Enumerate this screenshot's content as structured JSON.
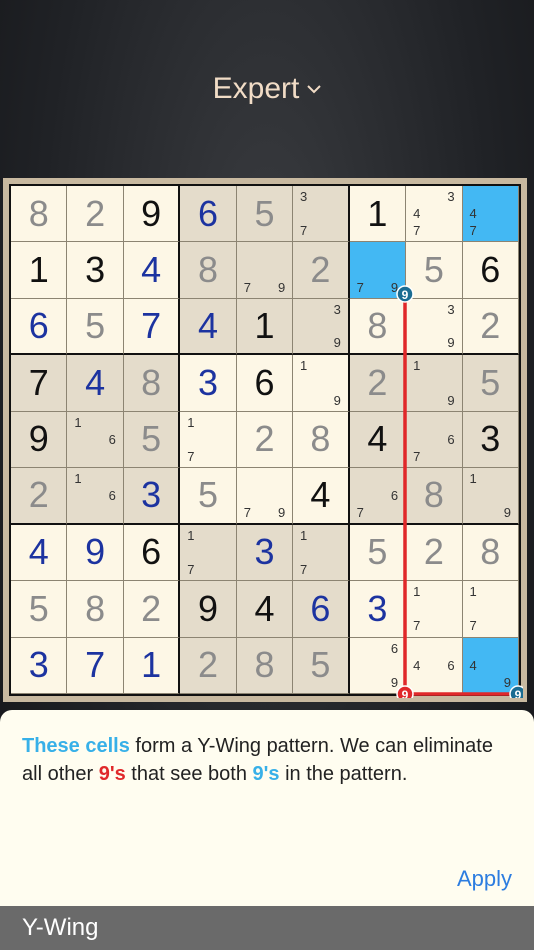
{
  "header": {
    "title": "Expert"
  },
  "colors": {
    "highlight": "#43b8f3",
    "chain": "#e0282a"
  },
  "board": {
    "rows": [
      [
        {
          "v": "8",
          "k": "given"
        },
        {
          "v": "2",
          "k": "given"
        },
        {
          "v": "9",
          "k": "black"
        },
        {
          "v": "6",
          "k": "blue"
        },
        {
          "v": "5",
          "k": "given"
        },
        {
          "c": [
            "3",
            "",
            "",
            "",
            "",
            "",
            "7",
            "",
            ""
          ]
        },
        {
          "v": "1",
          "k": "black"
        },
        {
          "c": [
            "",
            "",
            "3",
            "4",
            "",
            "",
            "7",
            "",
            ""
          ]
        },
        {
          "c": [
            "",
            "",
            "",
            "4",
            "",
            "",
            "7",
            "",
            ""
          ],
          "hl": true
        }
      ],
      [
        {
          "v": "1",
          "k": "black"
        },
        {
          "v": "3",
          "k": "black"
        },
        {
          "v": "4",
          "k": "blue"
        },
        {
          "v": "8",
          "k": "given"
        },
        {
          "c": [
            "",
            "",
            "",
            "",
            "",
            "",
            "7",
            "",
            "9"
          ]
        },
        {
          "v": "2",
          "k": "given"
        },
        {
          "c": [
            "",
            "",
            "",
            "",
            "",
            "",
            "7",
            "",
            "9"
          ],
          "hl": true
        },
        {
          "v": "5",
          "k": "given"
        },
        {
          "v": "6",
          "k": "black"
        }
      ],
      [
        {
          "v": "6",
          "k": "blue"
        },
        {
          "v": "5",
          "k": "given"
        },
        {
          "v": "7",
          "k": "blue"
        },
        {
          "v": "4",
          "k": "blue"
        },
        {
          "v": "1",
          "k": "black"
        },
        {
          "c": [
            "",
            "",
            "3",
            "",
            "",
            "",
            "",
            "",
            "9"
          ]
        },
        {
          "v": "8",
          "k": "given"
        },
        {
          "c": [
            "",
            "",
            "3",
            "",
            "",
            "",
            "",
            "",
            "9"
          ]
        },
        {
          "v": "2",
          "k": "given"
        }
      ],
      [
        {
          "v": "7",
          "k": "black"
        },
        {
          "v": "4",
          "k": "blue"
        },
        {
          "v": "8",
          "k": "given"
        },
        {
          "v": "3",
          "k": "blue"
        },
        {
          "v": "6",
          "k": "black"
        },
        {
          "c": [
            "1",
            "",
            "",
            "",
            "",
            "",
            "",
            "",
            "9"
          ]
        },
        {
          "v": "2",
          "k": "given"
        },
        {
          "c": [
            "1",
            "",
            "",
            "",
            "",
            "",
            "",
            "",
            "9"
          ]
        },
        {
          "v": "5",
          "k": "given"
        }
      ],
      [
        {
          "v": "9",
          "k": "black"
        },
        {
          "c": [
            "1",
            "",
            "",
            "",
            "",
            "6",
            "",
            "",
            ""
          ]
        },
        {
          "v": "5",
          "k": "given"
        },
        {
          "c": [
            "1",
            "",
            "",
            "",
            "",
            "",
            "7",
            "",
            ""
          ]
        },
        {
          "v": "2",
          "k": "given"
        },
        {
          "v": "8",
          "k": "given"
        },
        {
          "v": "4",
          "k": "black"
        },
        {
          "c": [
            "",
            "",
            "",
            "",
            "",
            "6",
            "7",
            "",
            ""
          ]
        },
        {
          "v": "3",
          "k": "black"
        }
      ],
      [
        {
          "v": "2",
          "k": "given"
        },
        {
          "c": [
            "1",
            "",
            "",
            "",
            "",
            "6",
            "",
            "",
            ""
          ]
        },
        {
          "v": "3",
          "k": "blue"
        },
        {
          "v": "5",
          "k": "given"
        },
        {
          "c": [
            "",
            "",
            "",
            "",
            "",
            "",
            "7",
            "",
            "9"
          ]
        },
        {
          "v": "4",
          "k": "black"
        },
        {
          "c": [
            "",
            "",
            "",
            "",
            "",
            "6",
            "7",
            "",
            ""
          ]
        },
        {
          "v": "8",
          "k": "given"
        },
        {
          "c": [
            "1",
            "",
            "",
            "",
            "",
            "",
            "",
            "",
            "9"
          ]
        }
      ],
      [
        {
          "v": "4",
          "k": "blue"
        },
        {
          "v": "9",
          "k": "blue"
        },
        {
          "v": "6",
          "k": "black"
        },
        {
          "c": [
            "1",
            "",
            "",
            "",
            "",
            "",
            "7",
            "",
            ""
          ]
        },
        {
          "v": "3",
          "k": "blue"
        },
        {
          "c": [
            "1",
            "",
            "",
            "",
            "",
            "",
            "7",
            "",
            ""
          ]
        },
        {
          "v": "5",
          "k": "given"
        },
        {
          "v": "2",
          "k": "given"
        },
        {
          "v": "8",
          "k": "given"
        }
      ],
      [
        {
          "v": "5",
          "k": "given"
        },
        {
          "v": "8",
          "k": "given"
        },
        {
          "v": "2",
          "k": "given"
        },
        {
          "v": "9",
          "k": "black"
        },
        {
          "v": "4",
          "k": "black"
        },
        {
          "v": "6",
          "k": "blue"
        },
        {
          "v": "3",
          "k": "blue"
        },
        {
          "c": [
            "1",
            "",
            "",
            "",
            "",
            "",
            "7",
            "",
            ""
          ]
        },
        {
          "c": [
            "1",
            "",
            "",
            "",
            "",
            "",
            "7",
            "",
            ""
          ]
        }
      ],
      [
        {
          "v": "3",
          "k": "blue"
        },
        {
          "v": "7",
          "k": "blue"
        },
        {
          "v": "1",
          "k": "blue"
        },
        {
          "v": "2",
          "k": "given"
        },
        {
          "v": "8",
          "k": "given"
        },
        {
          "v": "5",
          "k": "given"
        },
        {
          "c": [
            "",
            "",
            "6",
            "",
            "",
            "",
            "",
            "",
            "9"
          ]
        },
        {
          "c": [
            "",
            "",
            "",
            "4",
            "",
            "6",
            "",
            "",
            ""
          ]
        },
        {
          "c": [
            "",
            "",
            "",
            "4",
            "",
            "",
            "",
            "",
            "9"
          ],
          "hl": true
        }
      ]
    ]
  },
  "hint": {
    "part1": "These cells",
    "part2": " form a Y-Wing pattern. We can eliminate all other ",
    "part3": "9's",
    "part4": " that see both ",
    "part5": "9's",
    "part6": " in the pattern."
  },
  "apply_label": "Apply",
  "footer": {
    "technique": "Y-Wing"
  }
}
